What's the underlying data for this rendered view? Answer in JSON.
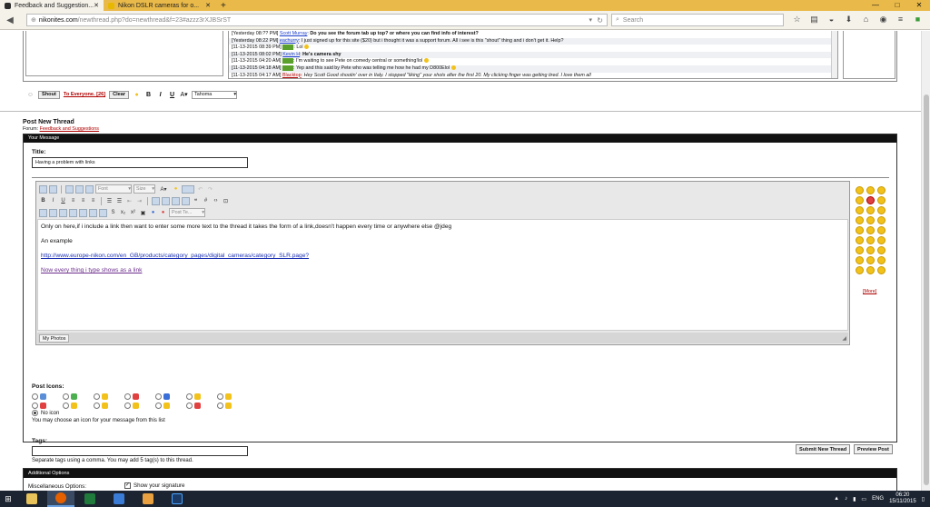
{
  "browser": {
    "tabs": [
      {
        "title": "Feedback and Suggestion...",
        "active": true,
        "color": "#2c2c2c"
      },
      {
        "title": "Nikon DSLR cameras for o...",
        "active": false,
        "color": "#e8b800"
      }
    ],
    "new_tab": "+",
    "window_controls": {
      "minimize": "—",
      "maximize": "□",
      "close": "✕"
    },
    "url": {
      "host": "nikonites.com",
      "path": "/newthread.php?do=newthread&f=23#azzz3rXJBSrST"
    },
    "search_placeholder": "Search"
  },
  "shoutbox": {
    "lines": [
      {
        "time": "[Yesterday 08:?? PM]",
        "user": "Scott Murray",
        "text": "Do you see the forum tab up top? or where you can find info of interest?"
      },
      {
        "time": "[Yesterday 08:22 PM]",
        "user": "eachurry",
        "text": "I just signed up for this site ($20) but i thought it was a support forum. All i see is this \"shout\" thing and i don't get it. Help?"
      },
      {
        "time": "[11-13-2015 08:39 PM]",
        "user": "■■■■",
        "text": "Lol"
      },
      {
        "time": "[11-13-2015 08:02 PM]",
        "user": "Kevin H",
        "text": "He's camera shy"
      },
      {
        "time": "[11-13-2015 04:20 AM]",
        "user": "■■■■",
        "text": "I'm waiting to see Pete on comedy central or something!lol"
      },
      {
        "time": "[11-13-2015 04:18 AM]",
        "user": "■■■■",
        "text": "Yep and this said by Pete who was telling me how he had my D800Elol"
      },
      {
        "time": "[11-13-2015 04:17 AM]",
        "user": "Blacktop",
        "text": "Hey Scott Good shootin' over in Italy. I stopped \"liking\" your shots after the first 20. My clicking finger was getting tired. I love them all"
      }
    ],
    "toolbar": {
      "shout_label": "Shout",
      "to_everyone": "To Everyone. [26]",
      "clear_label": "Clear",
      "bold": "B",
      "italic": "I",
      "underline": "U",
      "font": "Tahoma"
    }
  },
  "post": {
    "heading": "Post New Thread",
    "forum_prefix": "Forum:",
    "forum_name": "Feedback and Suggestions",
    "your_message": "Your Message",
    "title_label": "Title:",
    "title_value": "Having a problem with links",
    "editor": {
      "font_label": "Font",
      "size_label": "Size",
      "post_template": "Post Te...",
      "bold": "B",
      "italic": "I",
      "underline": "U",
      "paragraphs": [
        "Only on here,if i include a link then want to enter some more text to the thread it takes the form of a link,doesn't happen every time or anywhere else @jdeg",
        "An example"
      ],
      "link_url": "http://www.europe-nikon.com/en_GB/products/category_pages/digital_cameras/category_SLR.page?",
      "link_text": "Now every thing i type shows as a link",
      "my_photos": "My Photos"
    },
    "smilies_more": "[More]",
    "post_icons_label": "Post Icons:",
    "icon_colors": [
      "#5a8fd8",
      "#4caf50",
      "#f2c21b",
      "#e04040",
      "#3a6ed8",
      "#f2c21b",
      "#f2c21b",
      "#e04040",
      "#f2c21b",
      "#f2c21b",
      "#f2c21b",
      "#f2c21b",
      "#e04040",
      "#f2c21b"
    ],
    "no_icon_label": "No icon",
    "icon_help": "You may choose an icon for your message from this list",
    "tags_label": "Tags:",
    "tags_help": "Separate tags using a comma. You may add 5 tag(s) to this thread.",
    "submit_label": "Submit New Thread",
    "preview_label": "Preview Post"
  },
  "additional": {
    "heading": "Additional Options",
    "misc_label": "Miscellaneous Options:",
    "show_signature": "Show your signature"
  },
  "taskbar": {
    "apps": [
      {
        "name": "file-explorer",
        "color": "#e8c25a"
      },
      {
        "name": "firefox",
        "color": "#e66000",
        "active": true
      },
      {
        "name": "excel",
        "color": "#1f7a3c"
      },
      {
        "name": "photo-viewer",
        "color": "#3a7bd5"
      },
      {
        "name": "app-5",
        "color": "#e8a040"
      },
      {
        "name": "photoshop",
        "color": "#1b3a66"
      }
    ],
    "language": "ENG",
    "time": "06:20",
    "date": "15/11/2015"
  }
}
